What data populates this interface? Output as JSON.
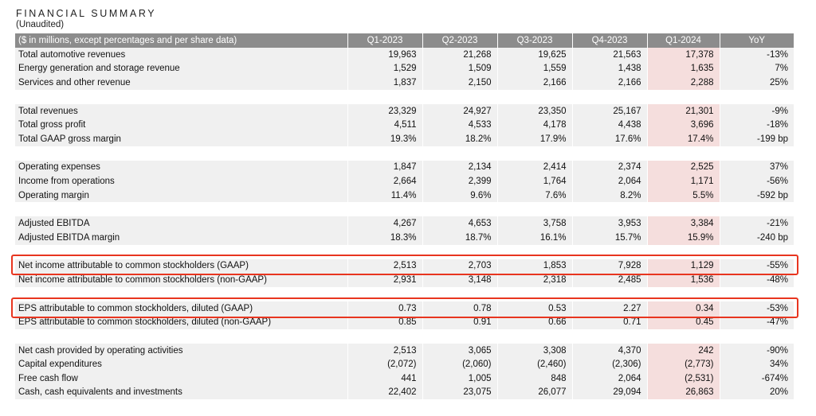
{
  "header": {
    "title": "FINANCIAL SUMMARY",
    "subtitle": "(Unaudited)"
  },
  "table": {
    "columns": [
      "($ in millions, except percentages and per share data)",
      "Q1-2023",
      "Q2-2023",
      "Q3-2023",
      "Q4-2023",
      "Q1-2024",
      "YoY"
    ],
    "groups": [
      [
        [
          "Total automotive revenues",
          "19,963",
          "21,268",
          "19,625",
          "21,563",
          "17,378",
          "-13%"
        ],
        [
          "Energy generation and storage revenue",
          "1,529",
          "1,509",
          "1,559",
          "1,438",
          "1,635",
          "7%"
        ],
        [
          "Services and other revenue",
          "1,837",
          "2,150",
          "2,166",
          "2,166",
          "2,288",
          "25%"
        ]
      ],
      [
        [
          "Total revenues",
          "23,329",
          "24,927",
          "23,350",
          "25,167",
          "21,301",
          "-9%"
        ],
        [
          "Total gross profit",
          "4,511",
          "4,533",
          "4,178",
          "4,438",
          "3,696",
          "-18%"
        ],
        [
          "Total GAAP gross margin",
          "19.3%",
          "18.2%",
          "17.9%",
          "17.6%",
          "17.4%",
          "-199 bp"
        ]
      ],
      [
        [
          "Operating expenses",
          "1,847",
          "2,134",
          "2,414",
          "2,374",
          "2,525",
          "37%"
        ],
        [
          "Income from operations",
          "2,664",
          "2,399",
          "1,764",
          "2,064",
          "1,171",
          "-56%"
        ],
        [
          "Operating margin",
          "11.4%",
          "9.6%",
          "7.6%",
          "8.2%",
          "5.5%",
          "-592 bp"
        ]
      ],
      [
        [
          "Adjusted EBITDA",
          "4,267",
          "4,653",
          "3,758",
          "3,953",
          "3,384",
          "-21%"
        ],
        [
          "Adjusted EBITDA margin",
          "18.3%",
          "18.7%",
          "16.1%",
          "15.7%",
          "15.9%",
          "-240 bp"
        ]
      ],
      [
        [
          "Net income attributable to common stockholders (GAAP)",
          "2,513",
          "2,703",
          "1,853",
          "7,928",
          "1,129",
          "-55%"
        ],
        [
          "Net income attributable to common stockholders (non-GAAP)",
          "2,931",
          "3,148",
          "2,318",
          "2,485",
          "1,536",
          "-48%"
        ]
      ],
      [
        [
          "EPS attributable to common stockholders, diluted (GAAP)",
          "0.73",
          "0.78",
          "0.53",
          "2.27",
          "0.34",
          "-53%"
        ],
        [
          "EPS attributable to common stockholders, diluted (non-GAAP)",
          "0.85",
          "0.91",
          "0.66",
          "0.71",
          "0.45",
          "-47%"
        ]
      ],
      [
        [
          "Net cash provided by operating activities",
          "2,513",
          "3,065",
          "3,308",
          "4,370",
          "242",
          "-90%"
        ],
        [
          "Capital expenditures",
          "(2,072)",
          "(2,060)",
          "(2,460)",
          "(2,306)",
          "(2,773)",
          "34%"
        ],
        [
          "Free cash flow",
          "441",
          "1,005",
          "848",
          "2,064",
          "(2,531)",
          "-674%"
        ],
        [
          "Cash, cash equivalents and investments",
          "22,402",
          "23,075",
          "26,077",
          "29,094",
          "26,863",
          "20%"
        ]
      ]
    ]
  },
  "colors": {
    "header_bg": "#8c8c8c",
    "row_bg": "#f0f0f0",
    "highlight_col_bg": "#f5dedd",
    "annotation_circle": "#e8351f"
  }
}
